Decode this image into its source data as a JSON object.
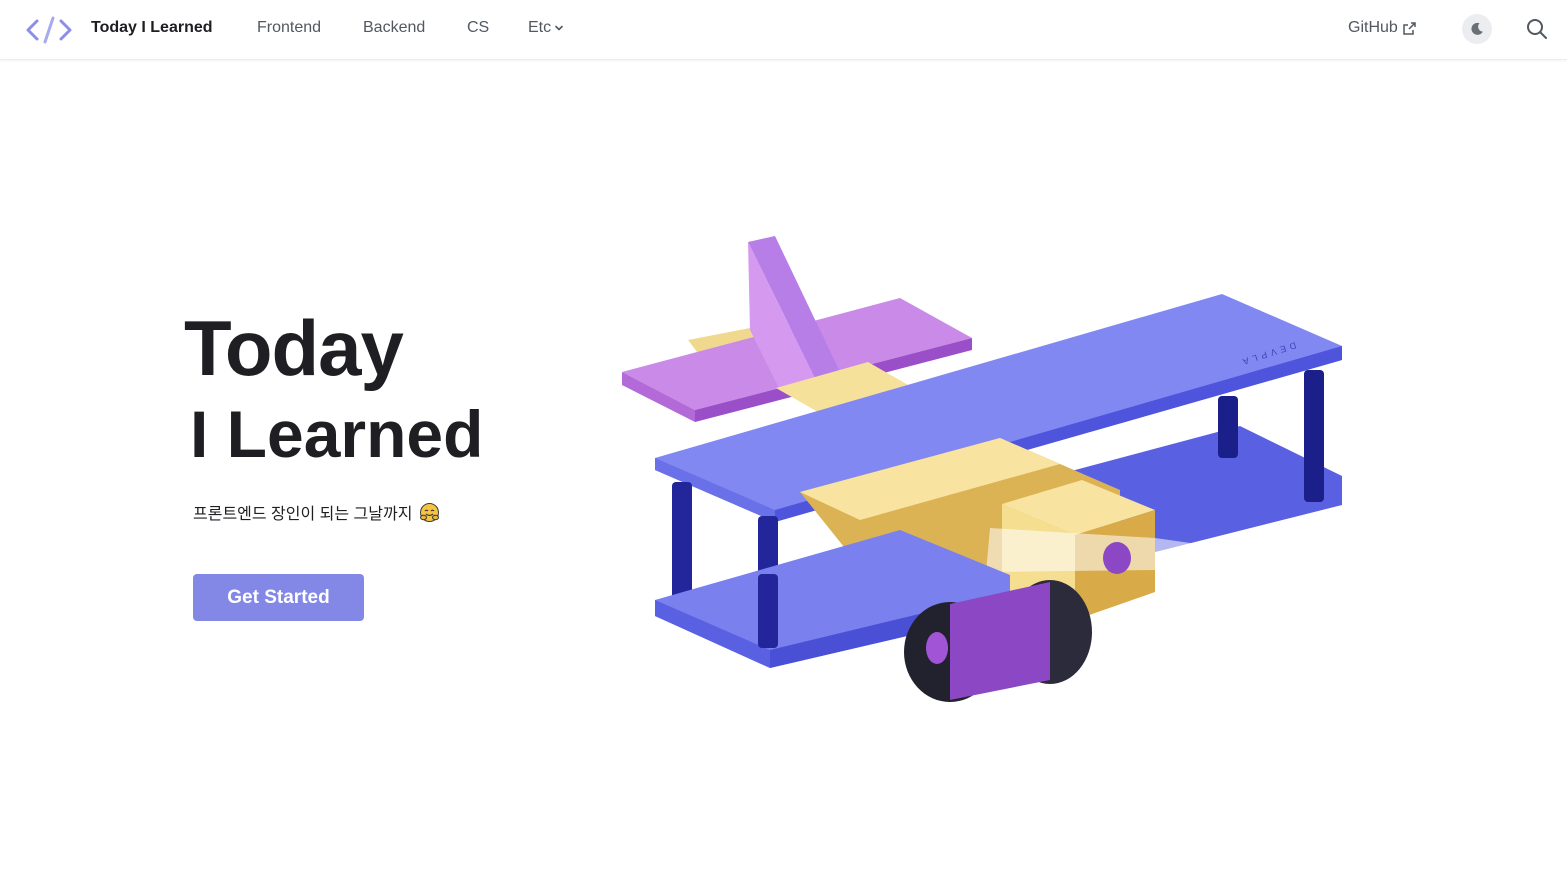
{
  "nav": {
    "brand": "Today I Learned",
    "links": [
      "Frontend",
      "Backend",
      "CS"
    ],
    "etc_label": "Etc",
    "github_label": "GitHub",
    "icons": {
      "logo": "code-brackets-icon",
      "dropdown": "chevron-down-icon",
      "external": "external-link-icon",
      "theme": "moon-icon",
      "search": "search-icon"
    }
  },
  "hero": {
    "title_line1": "Today",
    "title_line2": "I Learned",
    "tagline": "프론트엔드 장인이 되는 그날까지",
    "cta_label": "Get Started",
    "illustration_label": "DEVPLA"
  },
  "colors": {
    "accent": "#8387e6",
    "text": "#1f1f23",
    "nav_text": "#525860"
  }
}
